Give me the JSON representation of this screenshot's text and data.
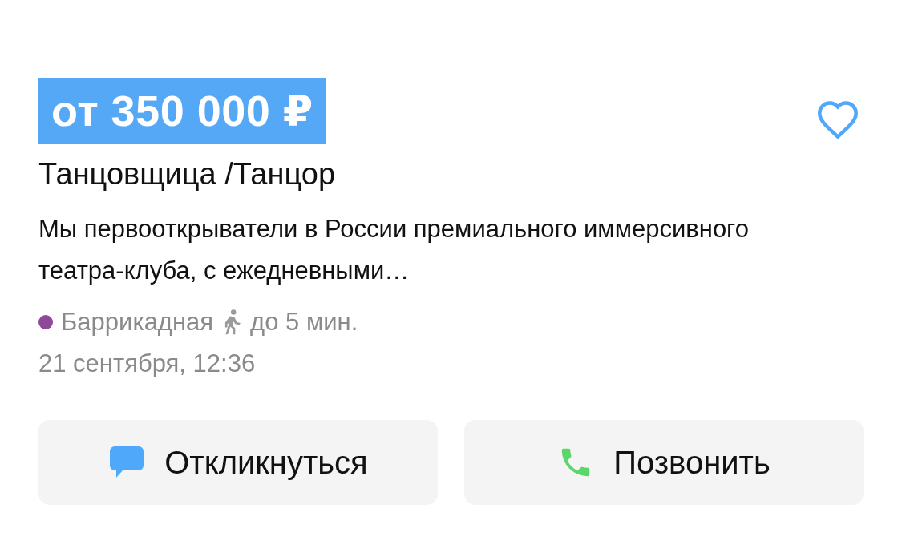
{
  "price": "от 350 000 ₽",
  "favorite": false,
  "title": "Танцовщица /Танцор",
  "description": "Мы первооткрыватели в России премиального иммерсивного театра-клуба, с ежедневными…",
  "metro": {
    "station": "Баррикадная",
    "color": "#8e4a98",
    "walk": "до 5 мин."
  },
  "date": "21 сентября, 12:36",
  "buttons": [
    {
      "kind": "respond",
      "label": "Откликнуться"
    },
    {
      "kind": "call",
      "label": "Позвонить"
    }
  ]
}
